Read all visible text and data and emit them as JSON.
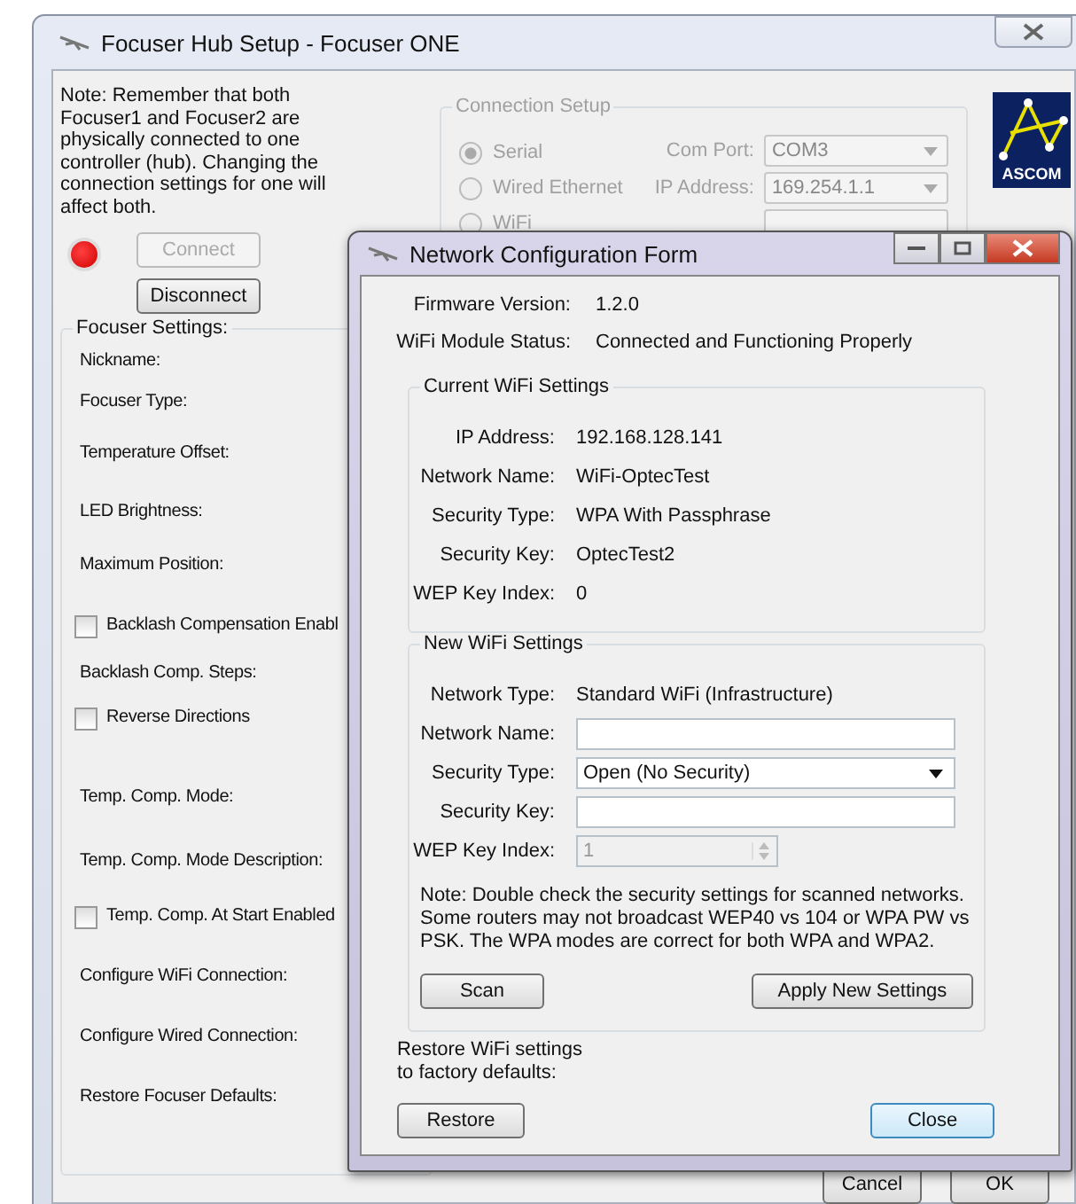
{
  "main_window": {
    "title": "Focuser Hub Setup - Focuser ONE",
    "note": "Note: Remember that both Focuser1 and Focuser2 are physically connected to one controller (hub). Changing the connection settings for one will affect both.",
    "led": {
      "lit": true
    },
    "connect_button": {
      "label": "Connect",
      "disabled": true
    },
    "disconnect_button": {
      "label": "Disconnect",
      "disabled": false
    },
    "connection_setup": {
      "title": "Connection Setup",
      "disabled": true,
      "options": [
        {
          "label": "Serial",
          "selected": true
        },
        {
          "label": "Wired Ethernet",
          "selected": false
        },
        {
          "label": "WiFi",
          "selected": false
        }
      ],
      "com_port": {
        "label": "Com Port:",
        "value": "COM3"
      },
      "ip_address": {
        "label": "IP Address:",
        "value": "169.254.1.1"
      }
    },
    "logo": {
      "text": "ASCOM"
    },
    "focuser_settings": {
      "title": "Focuser Settings:",
      "rows": [
        {
          "kind": "label",
          "label": "Nickname:"
        },
        {
          "kind": "label",
          "label": "Focuser Type:"
        },
        {
          "kind": "label",
          "label": "Temperature Offset:"
        },
        {
          "kind": "label",
          "label": "LED Brightness:"
        },
        {
          "kind": "label",
          "label": "Maximum Position:"
        },
        {
          "kind": "checkbox",
          "label": "Backlash Compensation Enabl",
          "checked": false
        },
        {
          "kind": "label",
          "label": "Backlash Comp. Steps:"
        },
        {
          "kind": "checkbox",
          "label": "Reverse Directions",
          "checked": false
        },
        {
          "kind": "label",
          "label": "Temp. Comp. Mode:"
        },
        {
          "kind": "label",
          "label": "Temp. Comp. Mode Description:"
        },
        {
          "kind": "checkbox",
          "label": "Temp. Comp. At Start Enabled",
          "checked": false
        },
        {
          "kind": "label",
          "label": "Configure WiFi Connection:"
        },
        {
          "kind": "label",
          "label": "Configure Wired Connection:"
        },
        {
          "kind": "label",
          "label": "Restore Focuser Defaults:"
        }
      ]
    },
    "buttons": [
      {
        "label": "Cancel"
      },
      {
        "label": "OK"
      }
    ]
  },
  "network_form": {
    "title": "Network Configuration Form",
    "info": [
      {
        "label": "Firmware Version:",
        "value": "1.2.0"
      },
      {
        "label": "WiFi Module Status:",
        "value": "Connected and Functioning Properly"
      }
    ],
    "current": {
      "title": "Current WiFi Settings",
      "rows": [
        {
          "label": "IP Address:",
          "value": "192.168.128.141"
        },
        {
          "label": "Network Name:",
          "value": "WiFi-OptecTest"
        },
        {
          "label": "Security Type:",
          "value": "WPA With Passphrase"
        },
        {
          "label": "Security Key:",
          "value": "OptecTest2"
        },
        {
          "label": "WEP Key Index:",
          "value": "0"
        }
      ]
    },
    "new": {
      "title": "New WiFi Settings",
      "network_type": {
        "label": "Network Type:",
        "value": "Standard WiFi (Infrastructure)"
      },
      "network_name": {
        "label": "Network Name:"
      },
      "security_type": {
        "label": "Security Type:",
        "value": "Open (No Security)"
      },
      "security_key": {
        "label": "Security Key:"
      },
      "wep_key_index": {
        "label": "WEP Key Index:",
        "value": "1",
        "disabled": true
      },
      "note": "Note: Double check the security settings for scanned networks. Some routers may not broadcast WEP40 vs 104 or WPA PW vs PSK. The WPA modes are correct for both WPA and WPA2.",
      "scan_button": "Scan",
      "apply_button": "Apply New Settings"
    },
    "restore_text": "Restore WiFi settings to factory defaults:",
    "restore_button": "Restore",
    "close_button": "Close"
  }
}
